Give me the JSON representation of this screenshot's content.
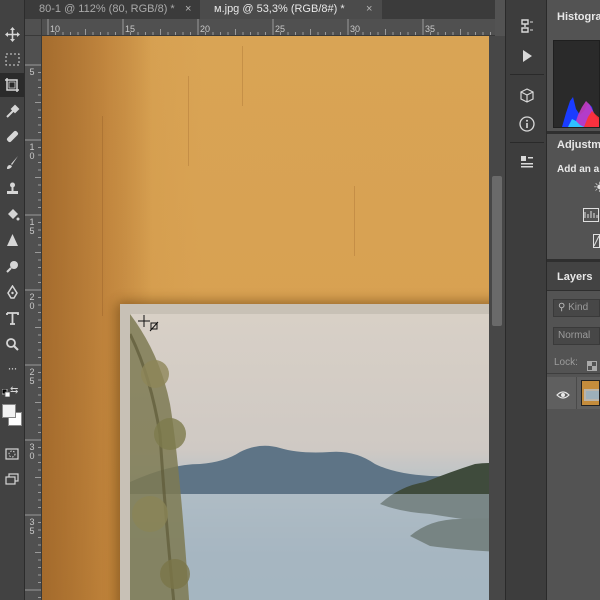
{
  "tabs": [
    {
      "label": "80-1 @ 112% (80, RGB/8) *",
      "close": "×"
    },
    {
      "label": "м.jpg @ 53,3% (RGB/8#) *",
      "close": "×"
    }
  ],
  "ruler_top": [
    "10",
    "15",
    "20",
    "25",
    "30",
    "35"
  ],
  "ruler_left": [
    [
      "5"
    ],
    [
      "1",
      "0"
    ],
    [
      "1",
      "5"
    ],
    [
      "2",
      "0"
    ],
    [
      "2",
      "5"
    ],
    [
      "3",
      "0"
    ],
    [
      "3",
      "5"
    ]
  ],
  "panels": {
    "histogram_title": "Histogram",
    "adjustments_title": "Adjustme",
    "adjustments_add": "Add an a",
    "layers_title": "Layers",
    "kind_label": "Kind",
    "blend_mode": "Normal",
    "lock_label": "Lock:"
  },
  "colors": {
    "accent": "#d8a152",
    "toolbar": "#424242",
    "panel_bg": "#535353"
  }
}
